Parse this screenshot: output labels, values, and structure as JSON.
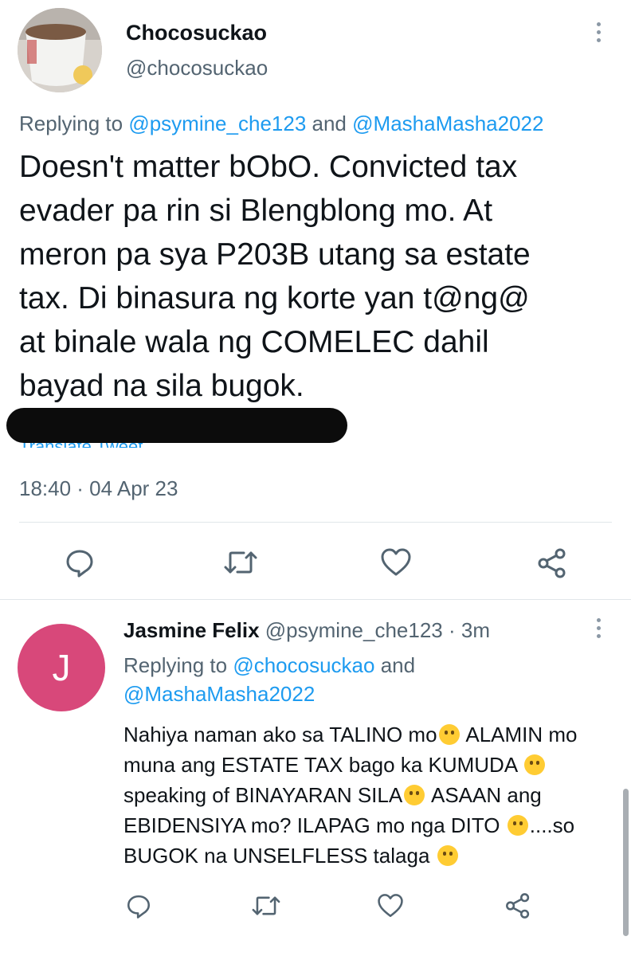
{
  "main_tweet": {
    "display_name": "Chocosuckao",
    "handle": "@chocosuckao",
    "replying_to_prefix": "Replying to",
    "replying_to_first": "@psymine_che123",
    "replying_to_and": "and",
    "replying_to_second": "@MashaMasha2022",
    "text": "Doesn't matter bObO. Convicted tax\nevader pa rin si Blengblong mo. At\nmeron pa sya P203B utang sa estate\ntax. Di binasura ng korte yan t@ng@\nat binale wala ng COMELEC dahil\nbayad na sila bugok.",
    "translate_link": "Translate Tweet",
    "timestamp": "18:40 · 04 Apr 23"
  },
  "reply_tweet": {
    "avatar_letter": "J",
    "display_name": "Jasmine Felix",
    "handle": "@psymine_che123",
    "time_ago": "· 3m",
    "replying_to_prefix": "Replying to",
    "replying_to_first": "@chocosuckao",
    "replying_to_and": "and",
    "replying_to_second": "@MashaMasha2022",
    "text_parts": [
      "Nahiya naman ako sa TALINO mo",
      " ALAMIN mo muna ang ESTATE TAX bago ka KUMUDA ",
      "speaking of BINAYARAN SILA",
      " ASAAN ang EBIDENSIYA mo? ILAPAG mo nga DITO ",
      "....so BUGOK na UNSELFLESS talaga "
    ],
    "emojis": [
      "rolling-laughing-emoji",
      "zany-face-emoji",
      "hand-over-mouth-emoji",
      "zany-face-emoji",
      "squinting-tongue-emoji"
    ]
  },
  "actions": [
    "reply-icon",
    "retweet-icon",
    "like-icon",
    "share-icon"
  ],
  "colors": {
    "link": "#1d9bf0",
    "secondary": "#536471",
    "text": "#0f1419",
    "reply_avatar": "#d8487a"
  }
}
